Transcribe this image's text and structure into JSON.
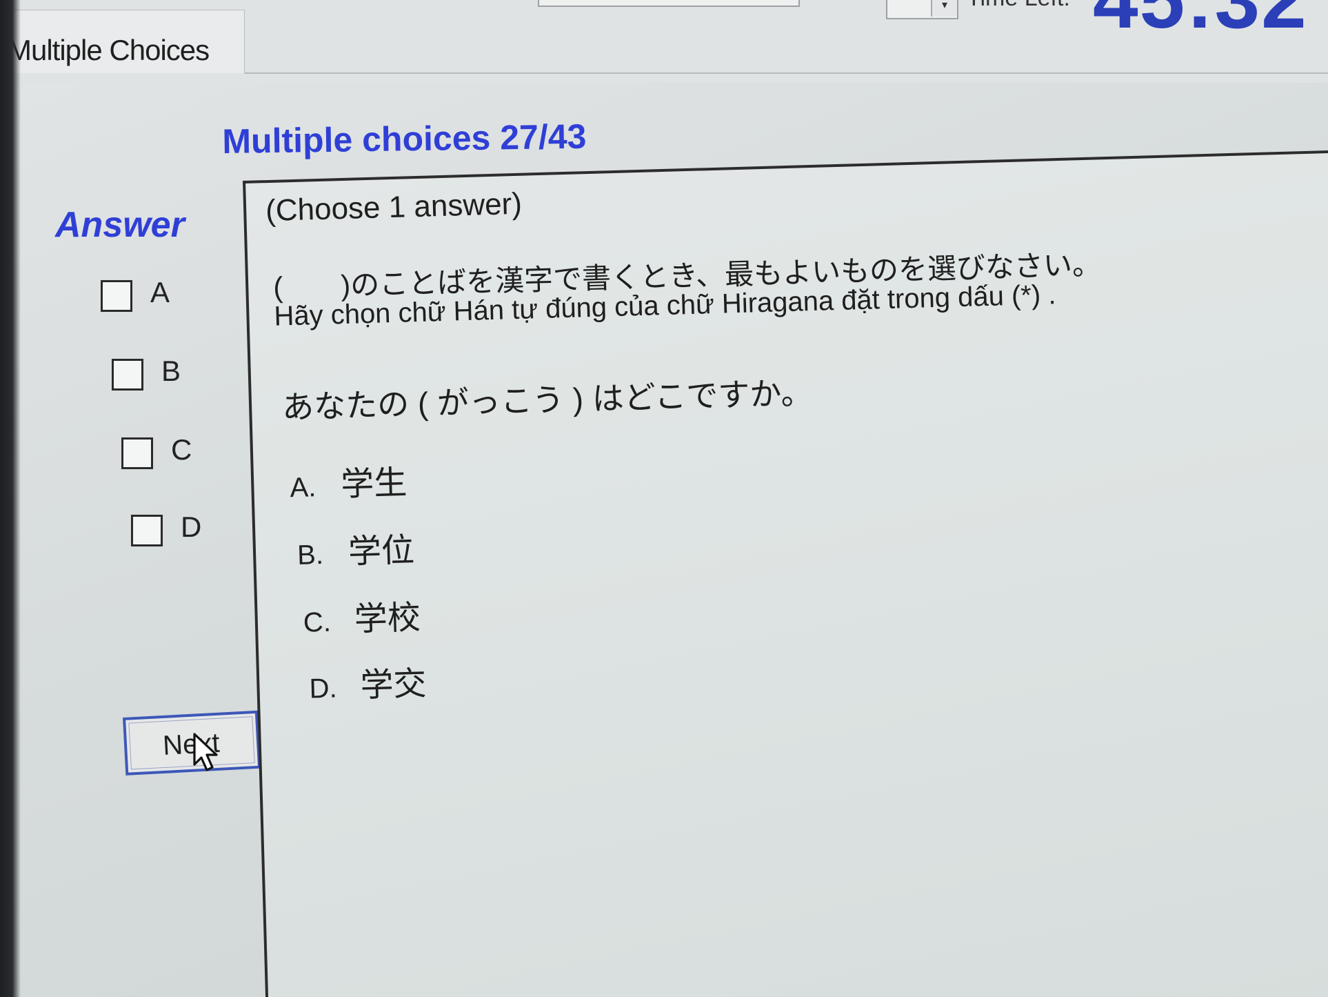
{
  "window": {
    "tab_label": "Multiple Choices",
    "time_left_label": "Time Left:",
    "time_left_value": "45:32",
    "dropdown_icon": "chevron-down-icon"
  },
  "header": {
    "section_title": "Multiple choices 27/43"
  },
  "answer_panel": {
    "title": "Answer",
    "options": [
      "A",
      "B",
      "C",
      "D"
    ],
    "next_label": "Next",
    "pointer_icon": "mouse-pointer-icon"
  },
  "question": {
    "instruction": "(Choose 1 answer)",
    "prompt_jp": "(　　)のことばを漢字で書くとき、最もよいものを選びなさい。",
    "prompt_vi": "Hãy chọn chữ Hán tự đúng của chữ Hiragana đặt trong dấu (*) .",
    "sentence": "あなたの ( がっこう ) はどこですか。",
    "choices": [
      {
        "letter": "A.",
        "text": "学生"
      },
      {
        "letter": "B.",
        "text": "学位"
      },
      {
        "letter": "C.",
        "text": "学校"
      },
      {
        "letter": "D.",
        "text": "学交"
      }
    ]
  },
  "colors": {
    "accent_blue": "#2f3fd6",
    "timer_blue": "#2b3fb8",
    "button_border": "#3d57b8"
  }
}
